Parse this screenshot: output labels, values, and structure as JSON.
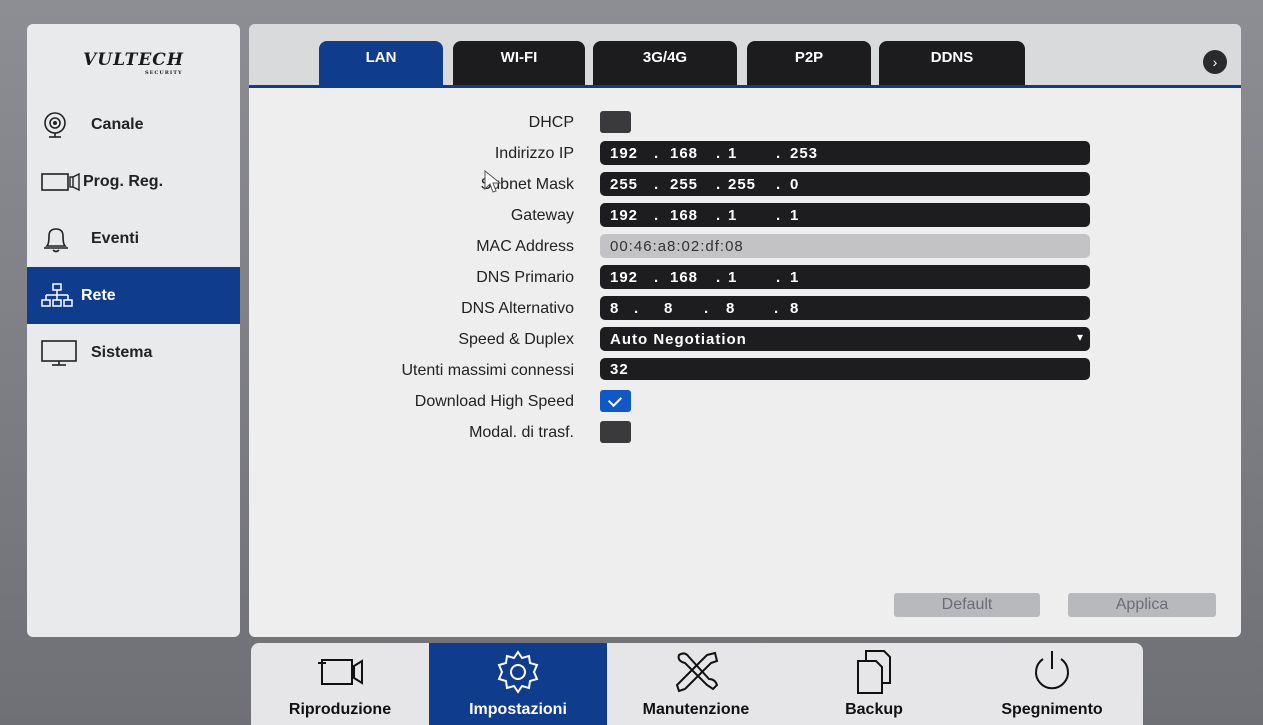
{
  "logo": {
    "text": "VULTECH",
    "sub": "SECURITY"
  },
  "sidebar": {
    "items": [
      {
        "label": "Canale",
        "icon": "camera-icon",
        "active": false
      },
      {
        "label": "Prog. Reg.",
        "icon": "record-icon",
        "active": false
      },
      {
        "label": "Eventi",
        "icon": "bell-icon",
        "active": false
      },
      {
        "label": "Rete",
        "icon": "network-icon",
        "active": true
      },
      {
        "label": "Sistema",
        "icon": "monitor-icon",
        "active": false
      }
    ]
  },
  "tabs": [
    {
      "label": "LAN",
      "active": true
    },
    {
      "label": "WI-FI",
      "active": false
    },
    {
      "label": "3G/4G",
      "active": false
    },
    {
      "label": "P2P",
      "active": false
    },
    {
      "label": "DDNS",
      "active": false
    }
  ],
  "form": {
    "dhcp": {
      "label": "DHCP",
      "checked": false
    },
    "ip": {
      "label": "Indirizzo IP",
      "segments": [
        "192",
        "168",
        "1",
        "253"
      ]
    },
    "subnet": {
      "label": "Subnet Mask",
      "segments": [
        "255",
        "255",
        "255",
        "0"
      ]
    },
    "gateway": {
      "label": "Gateway",
      "segments": [
        "192",
        "168",
        "1",
        "1"
      ]
    },
    "mac": {
      "label": "MAC Address",
      "value": "00:46:a8:02:df:08"
    },
    "dns1": {
      "label": "DNS Primario",
      "segments": [
        "192",
        "168",
        "1",
        "1"
      ]
    },
    "dns2": {
      "label": "DNS Alternativo",
      "segments": [
        "8",
        "8",
        "8",
        "8"
      ]
    },
    "speed": {
      "label": "Speed & Duplex",
      "value": "Auto Negotiation"
    },
    "max_users": {
      "label": "Utenti massimi connessi",
      "value": "32"
    },
    "download": {
      "label": "Download High Speed",
      "checked": true
    },
    "transfer": {
      "label": "Modal. di trasf.",
      "checked": false
    }
  },
  "buttons": {
    "default": "Default",
    "apply": "Applica"
  },
  "toolbar": [
    {
      "label": "Riproduzione",
      "icon": "video-camera-icon",
      "active": false
    },
    {
      "label": "Impostazioni",
      "icon": "gear-icon",
      "active": true
    },
    {
      "label": "Manutenzione",
      "icon": "tools-icon",
      "active": false
    },
    {
      "label": "Backup",
      "icon": "copy-icon",
      "active": false
    },
    {
      "label": "Spegnimento",
      "icon": "power-icon",
      "active": false
    }
  ],
  "colors": {
    "accent": "#0f3c8c",
    "field": "#1d1d20",
    "checked": "#1158c7"
  }
}
